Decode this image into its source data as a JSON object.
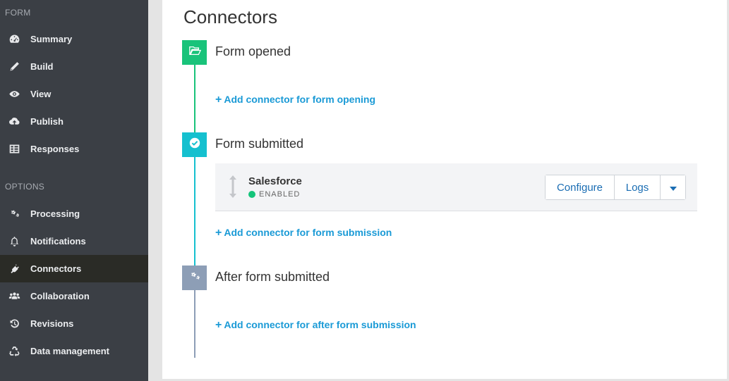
{
  "sidebar": {
    "sections": [
      {
        "label": "FORM",
        "items": [
          {
            "label": "Summary",
            "icon": "dashboard-icon"
          },
          {
            "label": "Build",
            "icon": "pencil-icon"
          },
          {
            "label": "View",
            "icon": "eye-icon"
          },
          {
            "label": "Publish",
            "icon": "cloud-upload-icon"
          },
          {
            "label": "Responses",
            "icon": "table-icon"
          }
        ]
      },
      {
        "label": "OPTIONS",
        "items": [
          {
            "label": "Processing",
            "icon": "gears-icon"
          },
          {
            "label": "Notifications",
            "icon": "bell-icon"
          },
          {
            "label": "Connectors",
            "icon": "plug-icon",
            "active": true
          },
          {
            "label": "Collaboration",
            "icon": "users-icon"
          },
          {
            "label": "Revisions",
            "icon": "history-icon"
          },
          {
            "label": "Data management",
            "icon": "recycle-icon"
          }
        ]
      }
    ]
  },
  "main": {
    "title": "Connectors",
    "steps": [
      {
        "title": "Form opened",
        "badge_color": "#19c37a",
        "icon": "folder-open-icon",
        "add_link": "Add connector for form opening"
      },
      {
        "title": "Form submitted",
        "badge_color": "#15c0cf",
        "icon": "check-circle-icon",
        "add_link": "Add connector for form submission",
        "connectors": [
          {
            "name": "Salesforce",
            "status": "ENABLED",
            "status_color": "#14c47a",
            "actions": {
              "configure": "Configure",
              "logs": "Logs"
            }
          }
        ]
      },
      {
        "title": "After form submitted",
        "badge_color": "#8d9eb6",
        "icon": "gears-icon",
        "add_link": "Add connector for after form submission"
      }
    ]
  },
  "colors": {
    "sidebar_bg": "#3b3f45",
    "sidebar_active": "#2a2b26",
    "link": "#1a9ad6",
    "button_text": "#1a6db3"
  }
}
